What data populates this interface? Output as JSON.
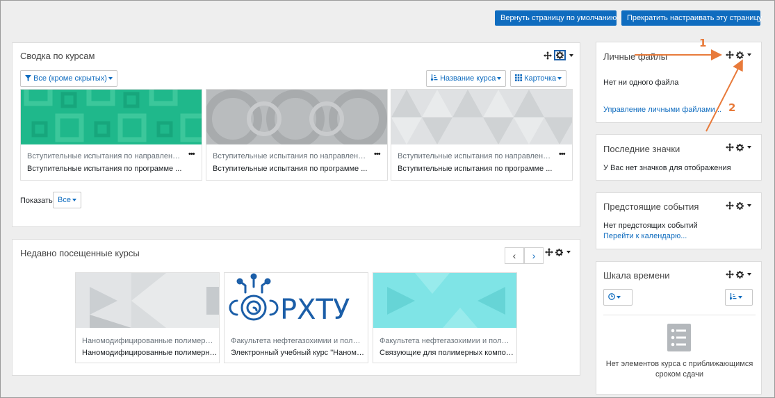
{
  "top_buttons": {
    "reset": "Вернуть страницу по умолчанию",
    "stop": "Прекратить настраивать эту страницу"
  },
  "course_overview": {
    "title": "Сводка по курсам",
    "filter": "Все (кроме скрытых)",
    "sort": "Название курса",
    "view": "Карточка",
    "courses": [
      {
        "category": "Вступительные испытания по направлению ...",
        "name": "Вступительные испытания по программе ...",
        "menu": "•••"
      },
      {
        "category": "Вступительные испытания по направлению ...",
        "name": "Вступительные испытания по программе ...",
        "menu": "•••"
      },
      {
        "category": "Вступительные испытания по направлению ...",
        "name": "Вступительные испытания по программе ...",
        "menu": "•••"
      }
    ],
    "show_label": "Показать",
    "show_value": "Все"
  },
  "recent_courses": {
    "title": "Недавно посещенные курсы",
    "logo_text": "РХТУ",
    "courses": [
      {
        "category": "Наномодифицированные полимерные...",
        "name": "Наномодифицированные полимерные..."
      },
      {
        "category": "Факультета нефтегазохимии и полиме...",
        "name": "Электронный учебный курс \"Наномод..."
      },
      {
        "category": "Факультета нефтегазохимии и полиме...",
        "name": "Связующие для полимерных компози..."
      }
    ]
  },
  "private_files": {
    "title": "Личные файлы",
    "empty": "Нет ни одного файла",
    "manage_link": "Управление личными файлами..."
  },
  "latest_badges": {
    "title": "Последние значки",
    "empty": "У Вас нет значков для отображения"
  },
  "upcoming_events": {
    "title": "Предстоящие события",
    "empty": "Нет предстоящих событий",
    "calendar_link": "Перейти к календарю..."
  },
  "timeline": {
    "title": "Шкала времени",
    "empty_line1": "Нет элементов курса с приближающимся",
    "empty_line2": "сроком сдачи"
  },
  "annotations": {
    "one": "1",
    "two": "2"
  },
  "colors": {
    "primary": "#0f6cbf",
    "annotation": "#e87a3a",
    "page_bg": "#eeeeee"
  },
  "icons": [
    "move-icon",
    "gear-icon",
    "filter-icon",
    "sort-icon",
    "grid-icon",
    "clock-icon",
    "chevron-left-icon",
    "chevron-right-icon",
    "list-icon"
  ]
}
